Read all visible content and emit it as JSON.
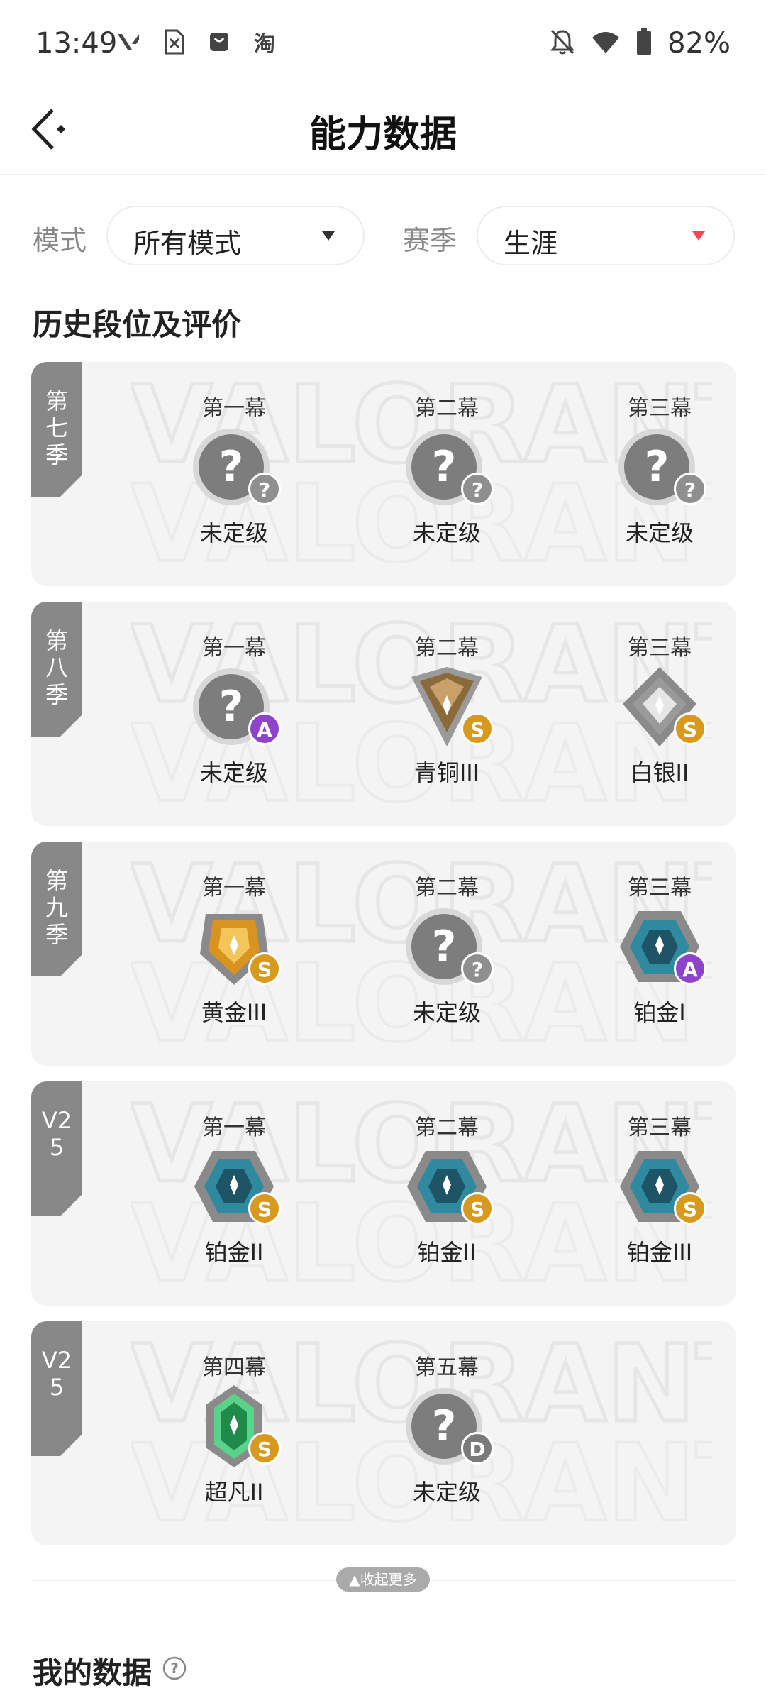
{
  "status_bar": {
    "time": "13:49",
    "left_icons": [
      "valorant-icon",
      "sim-off-icon",
      "bag-icon",
      "taobao-icon"
    ],
    "battery_text": "82%"
  },
  "header": {
    "title": "能力数据",
    "back_icon": "back-icon"
  },
  "filters": {
    "mode_label": "模式",
    "mode_value": "所有模式",
    "mode_arrow_color": "#333333",
    "season_label": "赛季",
    "season_value": "生涯",
    "season_arrow_color": "#ff4655"
  },
  "section_title": "历史段位及评价",
  "watermark": "VALORANT",
  "seasons": [
    {
      "tab": "第七季",
      "acts": [
        {
          "label": "第一幕",
          "rank": "未定级",
          "icon": "unranked",
          "grade": "?"
        },
        {
          "label": "第二幕",
          "rank": "未定级",
          "icon": "unranked",
          "grade": "?"
        },
        {
          "label": "第三幕",
          "rank": "未定级",
          "icon": "unranked",
          "grade": "?"
        }
      ]
    },
    {
      "tab": "第八季",
      "acts": [
        {
          "label": "第一幕",
          "rank": "未定级",
          "icon": "unranked",
          "grade": "A"
        },
        {
          "label": "第二幕",
          "rank": "青铜III",
          "icon": "bronze",
          "grade": "S"
        },
        {
          "label": "第三幕",
          "rank": "白银II",
          "icon": "silver",
          "grade": "S"
        }
      ]
    },
    {
      "tab": "第九季",
      "acts": [
        {
          "label": "第一幕",
          "rank": "黄金III",
          "icon": "gold",
          "grade": "S"
        },
        {
          "label": "第二幕",
          "rank": "未定级",
          "icon": "unranked",
          "grade": "?"
        },
        {
          "label": "第三幕",
          "rank": "铂金I",
          "icon": "platinum",
          "grade": "A"
        }
      ]
    },
    {
      "tab": "V25",
      "acts": [
        {
          "label": "第一幕",
          "rank": "铂金II",
          "icon": "platinum",
          "grade": "S"
        },
        {
          "label": "第二幕",
          "rank": "铂金II",
          "icon": "platinum",
          "grade": "S"
        },
        {
          "label": "第三幕",
          "rank": "铂金III",
          "icon": "platinum",
          "grade": "S"
        }
      ]
    },
    {
      "tab": "V25",
      "acts": [
        {
          "label": "第四幕",
          "rank": "超凡II",
          "icon": "ascendant",
          "grade": "S"
        },
        {
          "label": "第五幕",
          "rank": "未定级",
          "icon": "unranked",
          "grade": "D"
        }
      ]
    }
  ],
  "collapse_label": "收起更多",
  "my_data_title": "我的数据"
}
